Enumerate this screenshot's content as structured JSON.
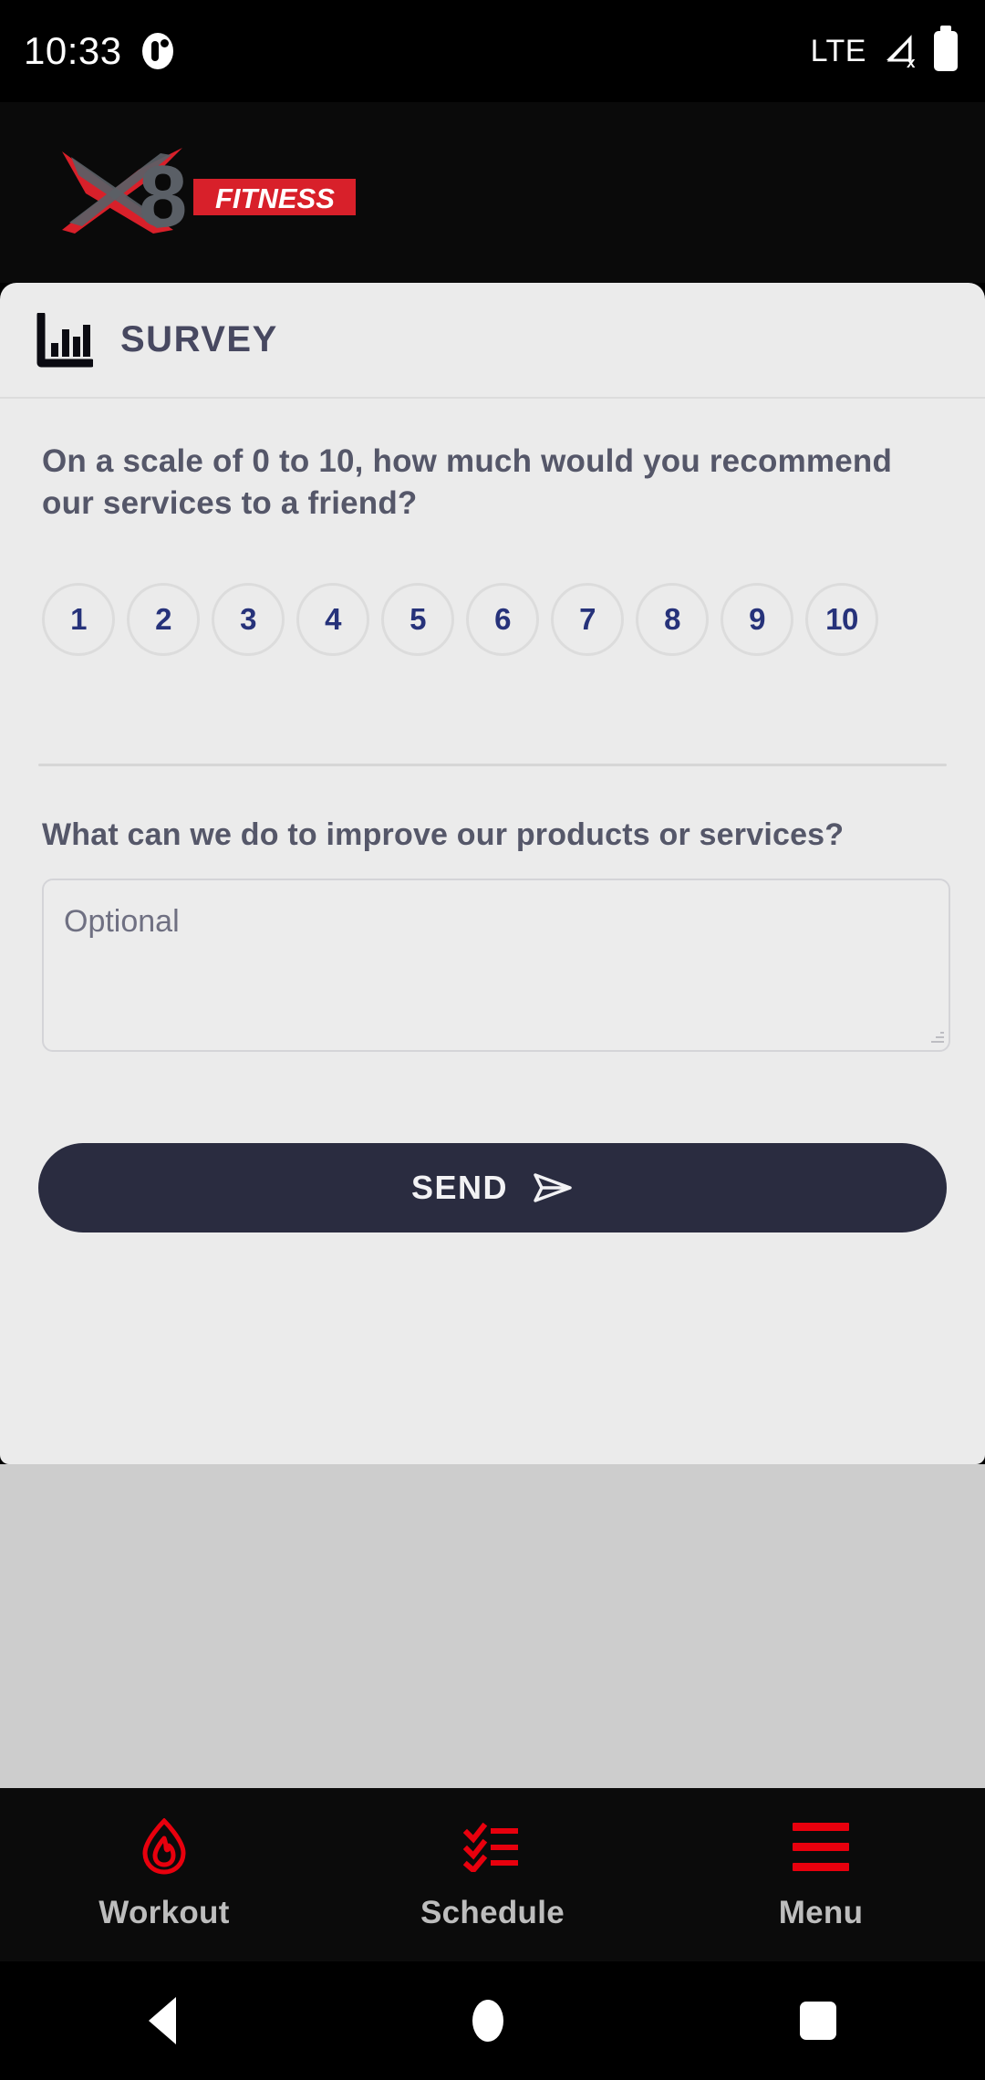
{
  "status_bar": {
    "time": "10:33",
    "notification_icon": "app-notification-icon",
    "network_label": "LTE",
    "signal_icon": "signal-no-data-icon",
    "battery_icon": "battery-full-icon"
  },
  "app_bar": {
    "logo_mark": "X8",
    "logo_banner": "FITNESS",
    "colors": {
      "red": "#e1232b",
      "gray": "#555a60"
    }
  },
  "card": {
    "header": {
      "icon": "bar-chart-icon",
      "title": "SURVEY"
    },
    "question_1": {
      "text": "On a scale of 0 to 10, how much would you recommend our services to a friend?",
      "options": [
        "1",
        "2",
        "3",
        "4",
        "5",
        "6",
        "7",
        "8",
        "9",
        "10"
      ],
      "selected": null
    },
    "question_2": {
      "label": "What can we do to improve our products or services?",
      "value": "",
      "placeholder": "Optional"
    },
    "submit": {
      "label": "SEND",
      "icon": "send-plane-icon",
      "color": "#2a2c40"
    }
  },
  "tab_bar": {
    "items": [
      {
        "label": "Workout",
        "icon": "flame-icon"
      },
      {
        "label": "Schedule",
        "icon": "checklist-icon"
      },
      {
        "label": "Menu",
        "icon": "hamburger-icon"
      }
    ],
    "accent": "#e8000d"
  },
  "nav_bar": {
    "back": "back-triangle-icon",
    "home": "home-circle-icon",
    "recents": "recents-square-icon"
  }
}
